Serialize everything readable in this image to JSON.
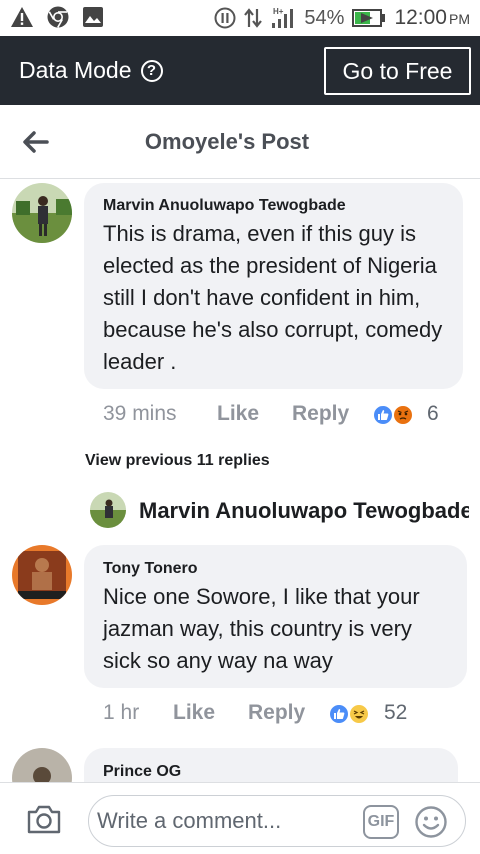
{
  "status_bar": {
    "battery_percent": "54%",
    "time": "12:00",
    "ampm": "PM",
    "network": "H+"
  },
  "data_bar": {
    "mode_label": "Data Mode",
    "info_icon": "?",
    "go_free_label": "Go to Free"
  },
  "header": {
    "title": "Omoyele's Post"
  },
  "comments": [
    {
      "name": "Marvin Anuoluwapo Tewogbade",
      "text": "This is drama, even if this guy is elected as the president of Nigeria still I don't have confident in him, because he's also corrupt, comedy leader .",
      "time": "39 mins",
      "like_label": "Like",
      "reply_label": "Reply",
      "reaction_count": "6"
    },
    {
      "name": "Tony Tonero",
      "text": "Nice one Sowore, I like that your jazman way, this country is very sick so any way na way",
      "time": "1 hr",
      "like_label": "Like",
      "reply_label": "Reply",
      "reaction_count": "52"
    },
    {
      "name": "Prince OG"
    }
  ],
  "replies": {
    "view_previous": "View previous 11 replies",
    "latest_reply_name": "Marvin Anuoluwapo Tewogbade"
  },
  "composer": {
    "placeholder": "Write a comment...",
    "gif_label": "GIF"
  },
  "colors": {
    "data_bar_bg": "#252a31",
    "bubble_bg": "#f1f2f5",
    "meta_text": "#90949c",
    "like_blue": "#4b8df8"
  }
}
